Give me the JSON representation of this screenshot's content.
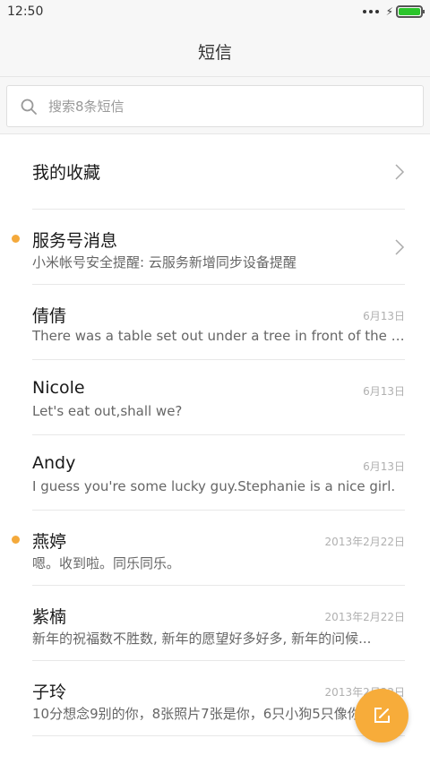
{
  "status_bar": {
    "time": "12:50"
  },
  "header": {
    "title": "短信"
  },
  "search": {
    "placeholder": "搜索8条短信"
  },
  "favorites": {
    "label": "我的收藏"
  },
  "threads": [
    {
      "name": "服务号消息",
      "preview": "小米帐号安全提醒: 云服务新增同步设备提醒",
      "date": "",
      "unread": true,
      "chevron": true
    },
    {
      "name": "倩倩",
      "preview": "There was a table set out under a tree in front of the ho...",
      "date": "6月13日",
      "unread": false,
      "chevron": false
    },
    {
      "name": "Nicole",
      "preview": "Let's eat out,shall we?",
      "date": "6月13日",
      "unread": false,
      "chevron": false
    },
    {
      "name": "Andy",
      "preview": "I guess you're some lucky guy.Stephanie is a nice girl.",
      "date": "6月13日",
      "unread": false,
      "chevron": false
    },
    {
      "name": "燕婷",
      "preview": "嗯。收到啦。同乐同乐。",
      "date": "2013年2月22日",
      "unread": true,
      "chevron": false
    },
    {
      "name": "紫楠",
      "preview": "新年的祝福数不胜数, 新年的愿望好多好多, 新年的问候...",
      "date": "2013年2月22日",
      "unread": false,
      "chevron": false
    },
    {
      "name": "子玲",
      "preview": "10分想念9别的你，8张照片7张是你，6只小狗5只像你",
      "date": "2013年2月22日",
      "unread": false,
      "chevron": false
    }
  ],
  "colors": {
    "accent": "#f7ac3a",
    "unread_dot": "#f4a93b",
    "battery": "#2bc52b"
  },
  "icons": {
    "search": "search-icon",
    "chevron": "chevron-right-icon",
    "compose": "compose-icon"
  }
}
